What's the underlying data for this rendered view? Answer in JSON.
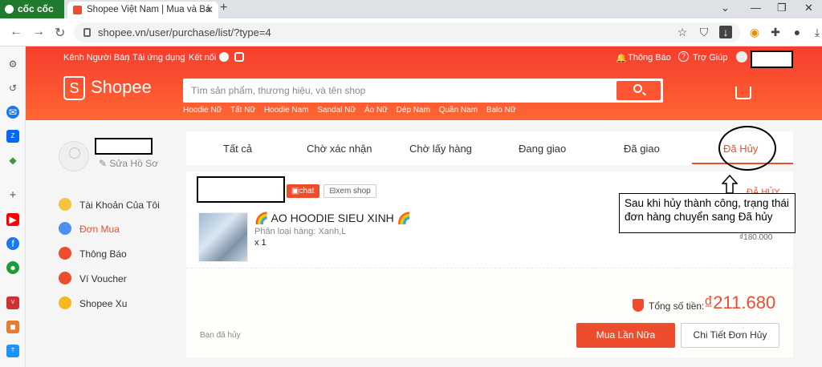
{
  "browser": {
    "brand": "cốc cốc",
    "tab_title": "Shopee Việt Nam | Mua và Bá",
    "url": "shopee.vn/user/purchase/list/?type=4"
  },
  "header": {
    "seller_center": "Kênh Người Bán",
    "download_app": "Tải ứng dụng",
    "connect": "Kết nối",
    "notifications": "Thông Báo",
    "help": "Trợ Giúp",
    "logo": "Shopee",
    "search_placeholder": "Tìm sản phẩm, thương hiệu, và tên shop",
    "suggestions": [
      "Hoodie Nữ",
      "Tất Nữ",
      "Hoodie Nam",
      "Sandal Nữ",
      "Áo Nữ",
      "Dép Nam",
      "Quần Nam",
      "Balo Nữ"
    ]
  },
  "profile": {
    "edit": "Sửa Hồ Sơ",
    "menu": [
      {
        "label": "Tài Khoản Của Tôi",
        "color": "#f5c242"
      },
      {
        "label": "Đơn Mua",
        "color": "#4e8ff0"
      },
      {
        "label": "Thông Báo",
        "color": "#ee4d2d"
      },
      {
        "label": "Ví Voucher",
        "color": "#ee4d2d"
      },
      {
        "label": "Shopee Xu",
        "color": "#f5b820"
      }
    ]
  },
  "tabs": [
    "Tất cả",
    "Chờ xác nhận",
    "Chờ lấy hàng",
    "Đang giao",
    "Đã giao",
    "Đã Hủy"
  ],
  "order": {
    "chat": "chat",
    "view_shop": "xem shop",
    "status": "ĐÃ HỦY",
    "product_name": "🌈 AO HOODIE SIEU XINH 🌈",
    "variant": "Phân loại hàng: Xanh,L",
    "quantity": "x 1",
    "price": "₫180.000",
    "total_label": "Tổng số tiền:",
    "total_value": "₫211.680",
    "cancelled_by": "Bạn đã hủy",
    "rebuy": "Mua Lần Nữa",
    "cancel_detail": "Chi Tiết Đơn Hủy"
  },
  "annotation": {
    "line1": "Sau khi hủy thành công, trạng thái",
    "line2": "đơn hàng chuyển sang Đã hủy"
  },
  "colors": {
    "brand": "#ee4d2d"
  }
}
